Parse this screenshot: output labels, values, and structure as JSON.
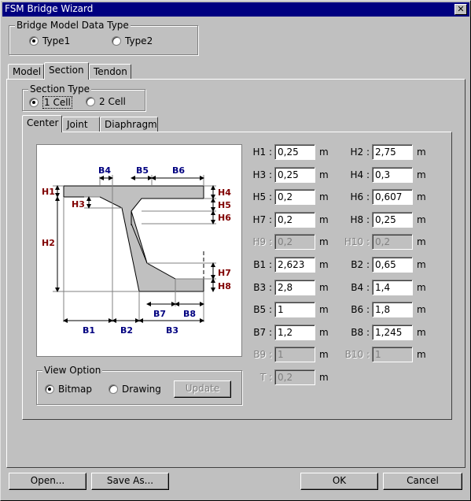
{
  "window": {
    "title": "FSM Bridge Wizard"
  },
  "model_type": {
    "label": "Bridge Model Data Type",
    "options": [
      "Type1",
      "Type2"
    ],
    "selected": "Type1"
  },
  "main_tabs": [
    "Model",
    "Section",
    "Tendon"
  ],
  "main_tab_active": "Section",
  "section_type": {
    "label": "Section Type",
    "options": [
      "1 Cell",
      "2 Cell"
    ],
    "selected": "1 Cell"
  },
  "sub_tabs": [
    "Center",
    "Joint",
    "Diaphragm"
  ],
  "sub_tab_active": "Center",
  "diagram": {
    "labels": {
      "H1": "H1",
      "H2": "H2",
      "H3": "H3",
      "H4": "H4",
      "H5": "H5",
      "H6": "H6",
      "H7": "H7",
      "H8": "H8",
      "B1": "B1",
      "B2": "B2",
      "B3": "B3",
      "B4": "B4",
      "B5": "B5",
      "B6": "B6",
      "B7": "B7",
      "B8": "B8"
    },
    "colors": {
      "h_label": "#800000",
      "b_label": "#000080",
      "fill": "#c0c0c0",
      "line": "#000000"
    }
  },
  "fields": [
    {
      "label": "H1 :",
      "value": "0,25",
      "unit": "m",
      "enabled": true
    },
    {
      "label": "H2 :",
      "value": "2,75",
      "unit": "m",
      "enabled": true
    },
    {
      "label": "H3 :",
      "value": "0,25",
      "unit": "m",
      "enabled": true
    },
    {
      "label": "H4 :",
      "value": "0,3",
      "unit": "m",
      "enabled": true
    },
    {
      "label": "H5 :",
      "value": "0,2",
      "unit": "m",
      "enabled": true
    },
    {
      "label": "H6 :",
      "value": "0,607",
      "unit": "m",
      "enabled": true
    },
    {
      "label": "H7 :",
      "value": "0,2",
      "unit": "m",
      "enabled": true
    },
    {
      "label": "H8 :",
      "value": "0,25",
      "unit": "m",
      "enabled": true
    },
    {
      "label": "H9 :",
      "value": "0,2",
      "unit": "m",
      "enabled": false
    },
    {
      "label": "H10 :",
      "value": "0,2",
      "unit": "m",
      "enabled": false
    },
    {
      "label": "B1 :",
      "value": "2,623",
      "unit": "m",
      "enabled": true
    },
    {
      "label": "B2 :",
      "value": "0,65",
      "unit": "m",
      "enabled": true
    },
    {
      "label": "B3 :",
      "value": "2,8",
      "unit": "m",
      "enabled": true
    },
    {
      "label": "B4 :",
      "value": "1,4",
      "unit": "m",
      "enabled": true
    },
    {
      "label": "B5 :",
      "value": "1",
      "unit": "m",
      "enabled": true
    },
    {
      "label": "B6 :",
      "value": "1,8",
      "unit": "m",
      "enabled": true
    },
    {
      "label": "B7 :",
      "value": "1,2",
      "unit": "m",
      "enabled": true
    },
    {
      "label": "B8 :",
      "value": "1,245",
      "unit": "m",
      "enabled": true
    },
    {
      "label": "B9 :",
      "value": "1",
      "unit": "m",
      "enabled": false
    },
    {
      "label": "B10 :",
      "value": "1",
      "unit": "m",
      "enabled": false
    },
    {
      "label": "T :",
      "value": "0,2",
      "unit": "m",
      "enabled": false
    }
  ],
  "view_option": {
    "label": "View Option",
    "options": [
      "Bitmap",
      "Drawing"
    ],
    "selected": "Bitmap",
    "update_label": "Update"
  },
  "buttons": {
    "open": "Open...",
    "save_as": "Save As...",
    "ok": "OK",
    "cancel": "Cancel"
  }
}
